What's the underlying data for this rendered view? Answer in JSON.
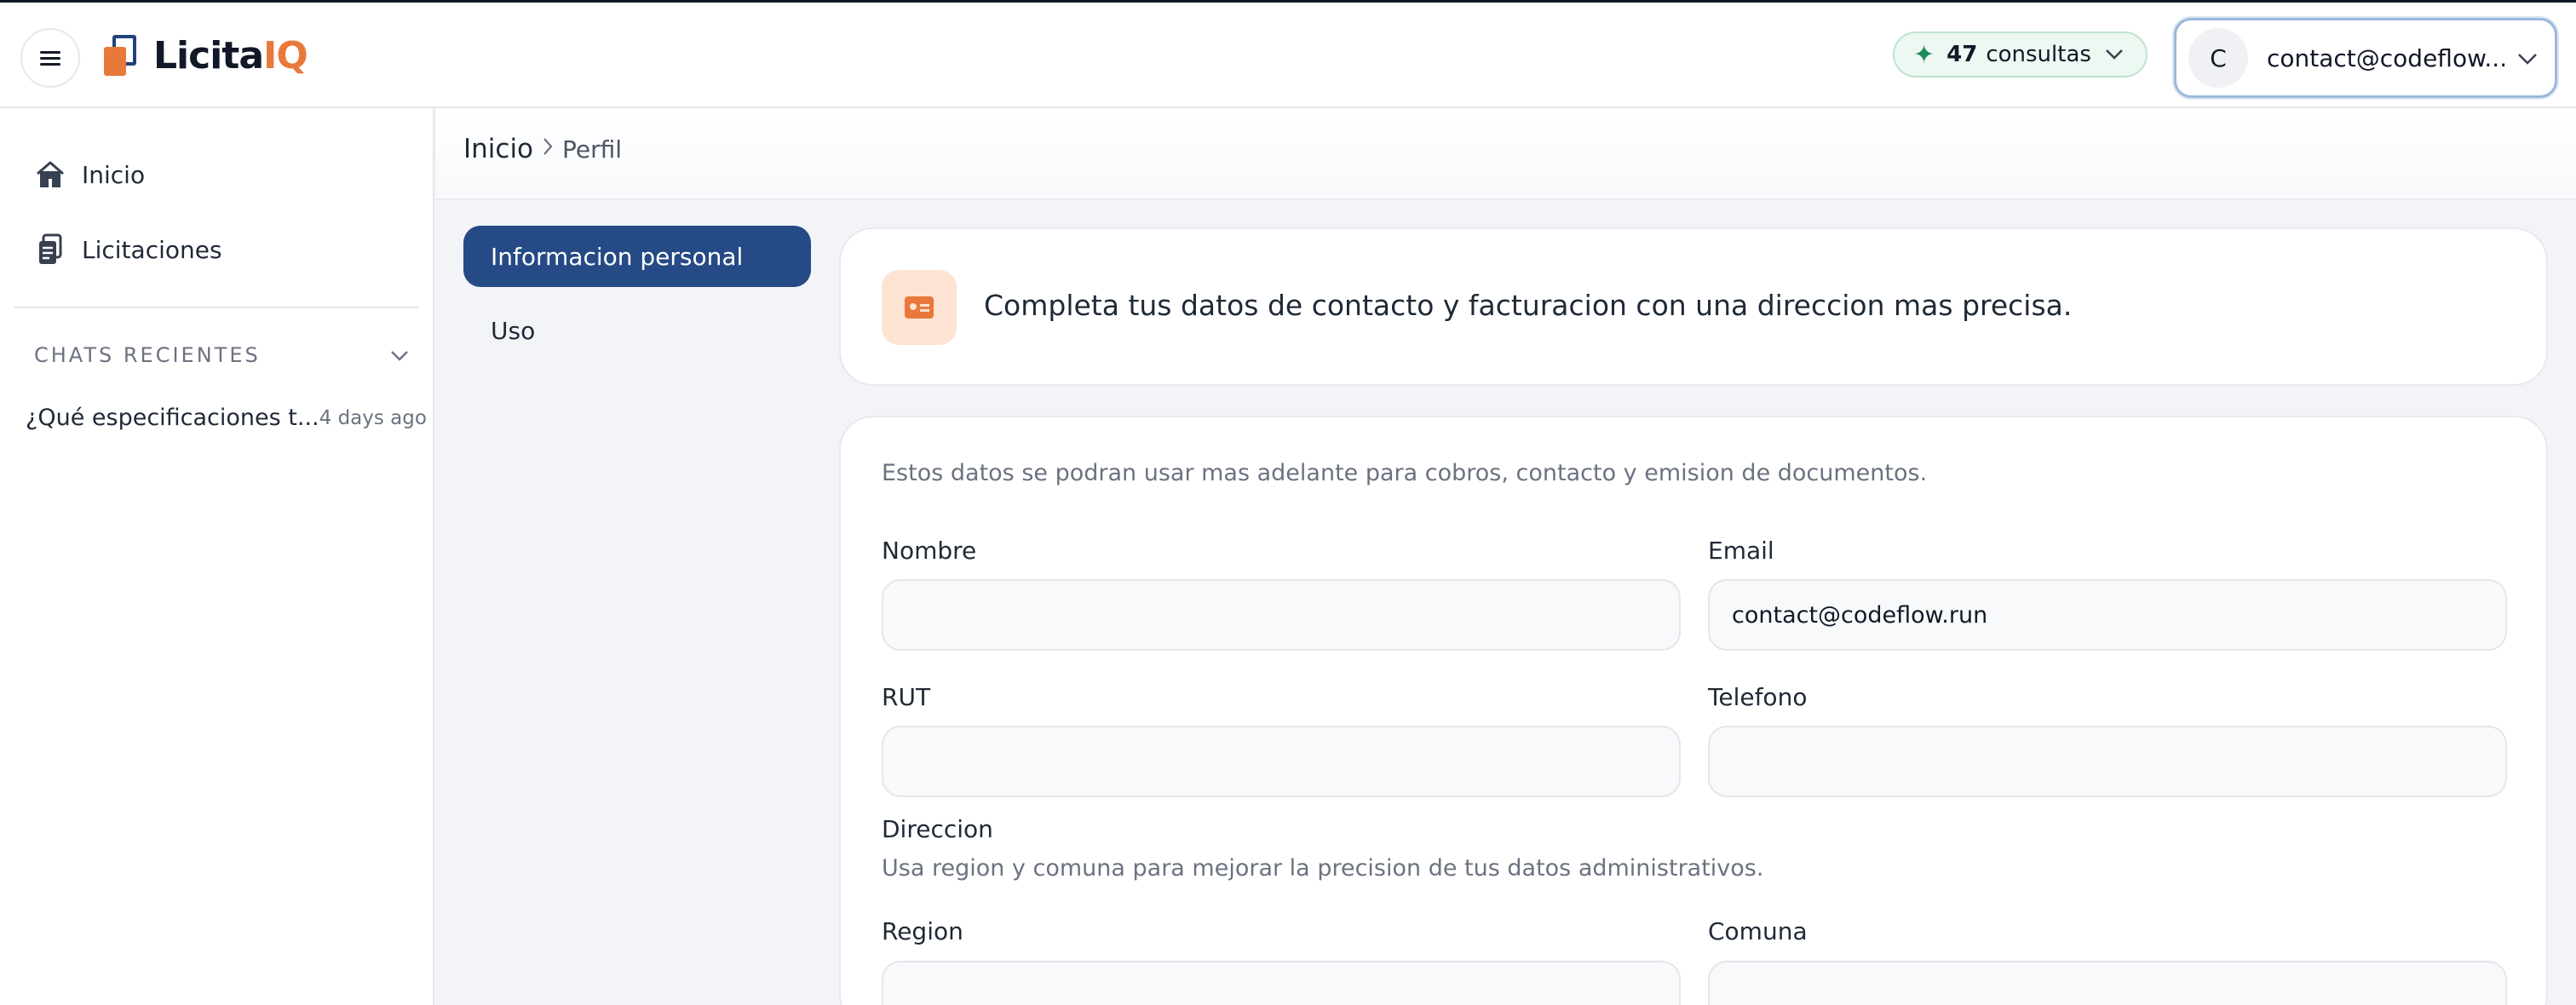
{
  "header": {
    "logo_text_main": "Licita",
    "logo_text_accent": "IQ",
    "credits_count": "47",
    "credits_label": "consultas",
    "account_initial": "C",
    "account_email": "contact@codeflow...."
  },
  "sidebar": {
    "items": [
      {
        "label": "Inicio",
        "icon": "home-icon"
      },
      {
        "label": "Licitaciones",
        "icon": "clipboard-icon"
      }
    ],
    "recent_header": "CHATS RECIENTES",
    "recent_chats": [
      {
        "title": "¿Qué especificaciones t...",
        "time": "4 days ago"
      }
    ]
  },
  "breadcrumb": {
    "root": "Inicio",
    "current": "Perfil"
  },
  "profile_tabs": [
    "Informacion personal",
    "Uso"
  ],
  "banner": {
    "text": "Completa tus datos de contacto y facturacion con una direccion mas precisa."
  },
  "form": {
    "description": "Estos datos se podran usar mas adelante para cobros, contacto y emision de documentos.",
    "nombre": {
      "label": "Nombre",
      "value": ""
    },
    "email": {
      "label": "Email",
      "value": "contact@codeflow.run"
    },
    "rut": {
      "label": "RUT",
      "value": ""
    },
    "telefono": {
      "label": "Telefono",
      "value": ""
    },
    "direccion_label": "Direccion",
    "direccion_hint": "Usa region y comuna para mejorar la precision de tus datos administrativos.",
    "region": {
      "label": "Region",
      "value": ""
    },
    "comuna": {
      "label": "Comuna",
      "value": ""
    }
  },
  "colors": {
    "primary": "#254a85",
    "accent": "#e8793a",
    "credits_green": "#1f8a5b"
  }
}
